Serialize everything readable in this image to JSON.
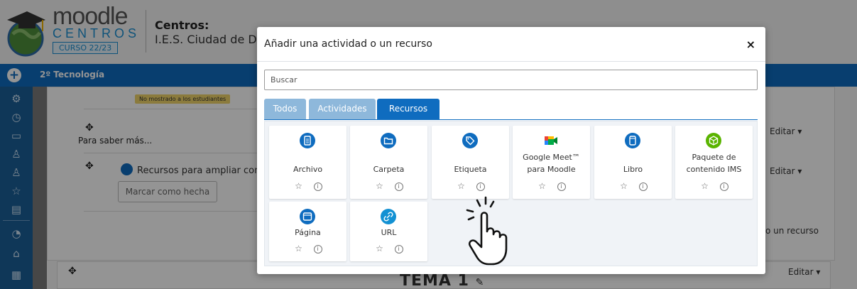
{
  "header": {
    "logo_word": "moodle",
    "logo_sub": "CENTROS",
    "logo_year": "CURSO 22/23",
    "title": "Centros:",
    "subtitle": "I.E.S. Ciudad de D"
  },
  "navbar": {
    "course": "2º Tecnología"
  },
  "course": {
    "hidden_badge": "No mostrado a los estudiantes",
    "section_title": "Para saber más...",
    "resource_title": "Recursos para ampliar conoc",
    "mark_button": "Marcar como hecha",
    "edit_label": "Editar ▾",
    "add_resource": "o un recurso",
    "topic_title": "TEMA 1"
  },
  "modal": {
    "title": "Añadir una actividad o un recurso",
    "close": "×",
    "search_placeholder": "Buscar",
    "tabs": [
      {
        "label": "Todos",
        "active": false
      },
      {
        "label": "Actividades",
        "active": false
      },
      {
        "label": "Recursos",
        "active": true
      }
    ],
    "items": [
      {
        "label": "Archivo",
        "icon": "file-icon",
        "color": "#0f6cbf"
      },
      {
        "label": "Carpeta",
        "icon": "folder-icon",
        "color": "#0f6cbf"
      },
      {
        "label": "Etiqueta",
        "icon": "tag-icon",
        "color": "#0f6cbf"
      },
      {
        "label_line1": "Google Meet™",
        "label_line2": "para Moodle",
        "icon": "google-meet-icon",
        "color": "#00832d"
      },
      {
        "label": "Libro",
        "icon": "book-icon",
        "color": "#0f6cbf"
      },
      {
        "label_line1": "Paquete de",
        "label_line2": "contenido IMS",
        "icon": "package-icon",
        "color": "#5ab400"
      },
      {
        "label": "Página",
        "icon": "page-icon",
        "color": "#0f6cbf"
      },
      {
        "label": "URL",
        "icon": "link-icon",
        "color": "#1391d3"
      }
    ],
    "star": "☆",
    "info": "i"
  }
}
